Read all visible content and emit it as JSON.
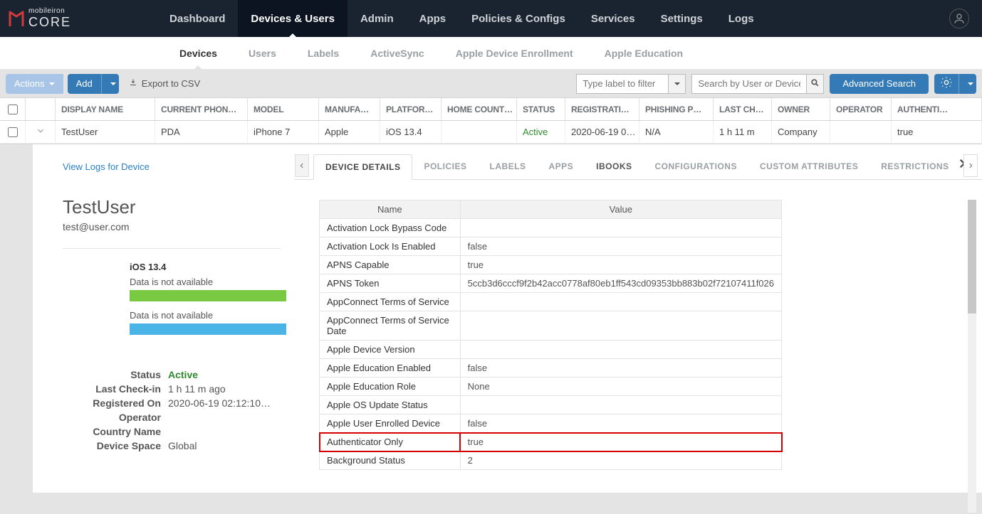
{
  "brand": {
    "name_small": "mobileiron",
    "name_big": "CORE"
  },
  "topnav": [
    "Dashboard",
    "Devices & Users",
    "Admin",
    "Apps",
    "Policies & Configs",
    "Services",
    "Settings",
    "Logs"
  ],
  "topnav_active": 1,
  "subnav": [
    "Devices",
    "Users",
    "Labels",
    "ActiveSync",
    "Apple Device Enrollment",
    "Apple Education"
  ],
  "subnav_active": 0,
  "toolbar": {
    "actions": "Actions",
    "add": "Add",
    "export": "Export to CSV",
    "label_placeholder": "Type label to filter",
    "search_placeholder": "Search by User or Device",
    "advanced": "Advanced Search"
  },
  "columns": [
    "DISPLAY NAME",
    "CURRENT PHON…",
    "MODEL",
    "MANUFA…",
    "PLATFOR…",
    "HOME COUNT…",
    "STATUS",
    "REGISTRATI…",
    "PHISHING P…",
    "LAST CH…",
    "OWNER",
    "OPERATOR",
    "AUTHENTI…"
  ],
  "row": {
    "display": "TestUser",
    "phone": "PDA",
    "model": "iPhone 7",
    "manu": "Apple",
    "plat": "iOS 13.4",
    "home": "",
    "status": "Active",
    "reg": "2020-06-19 0…",
    "phish": "N/A",
    "last": "1 h 11 m",
    "owner": "Company",
    "oper": "",
    "auth": "true"
  },
  "detail": {
    "loglink": "View Logs for Device",
    "user": "TestUser",
    "email": "test@user.com",
    "ios": "iOS 13.4",
    "na": "Data is not available",
    "kv": [
      {
        "k": "Status",
        "v": "Active",
        "cls": "active-green"
      },
      {
        "k": "Last Check-in",
        "v": "1 h 11 m ago"
      },
      {
        "k": "Registered On",
        "v": "2020-06-19 02:12:10…"
      },
      {
        "k": "Operator",
        "v": ""
      },
      {
        "k": "Country Name",
        "v": ""
      },
      {
        "k": "Device Space",
        "v": "Global"
      }
    ],
    "tabs": [
      "DEVICE DETAILS",
      "POLICIES",
      "LABELS",
      "APPS",
      "IBOOKS",
      "CONFIGURATIONS",
      "CUSTOM ATTRIBUTES",
      "RESTRICTIONS"
    ],
    "tab_active": 0,
    "th_name": "Name",
    "th_value": "Value",
    "rows": [
      {
        "n": "Activation Lock Bypass Code",
        "v": ""
      },
      {
        "n": "Activation Lock Is Enabled",
        "v": "false"
      },
      {
        "n": "APNS Capable",
        "v": "true"
      },
      {
        "n": "APNS Token",
        "v": "5ccb3d6cccf9f2b42acc0778af80eb1ff543cd09353bb883b02f72107411f026"
      },
      {
        "n": "AppConnect Terms of Service",
        "v": ""
      },
      {
        "n": "AppConnect Terms of Service Date",
        "v": ""
      },
      {
        "n": "Apple Device Version",
        "v": ""
      },
      {
        "n": "Apple Education Enabled",
        "v": "false"
      },
      {
        "n": "Apple Education Role",
        "v": "None"
      },
      {
        "n": "Apple OS Update Status",
        "v": ""
      },
      {
        "n": "Apple User Enrolled Device",
        "v": "false"
      },
      {
        "n": "Authenticator Only",
        "v": "true",
        "hl": true
      },
      {
        "n": "Background Status",
        "v": "2"
      }
    ]
  }
}
